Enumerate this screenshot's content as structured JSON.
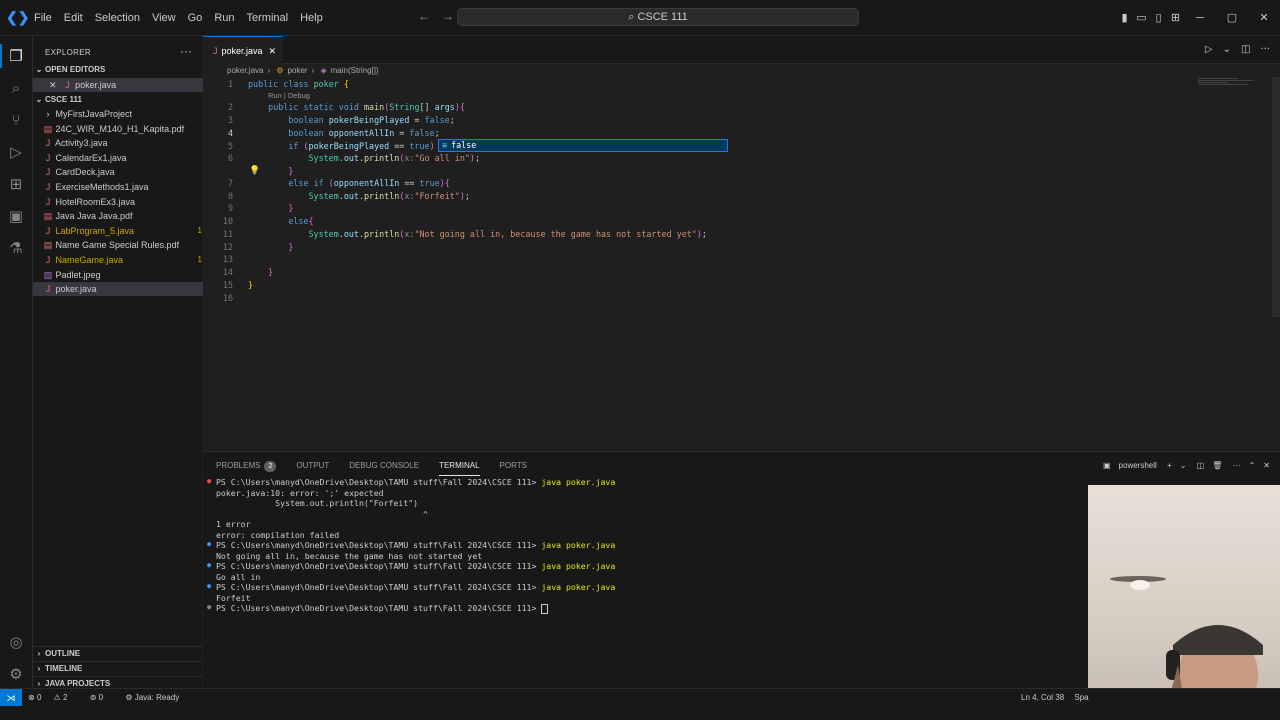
{
  "window": {
    "menu": [
      "File",
      "Edit",
      "Selection",
      "View",
      "Go",
      "Run",
      "Terminal",
      "Help"
    ],
    "command_center": "CSCE 111"
  },
  "sidebar": {
    "title": "EXPLORER",
    "open_editors_label": "OPEN EDITORS",
    "open_editors": [
      {
        "name": "poker.java"
      }
    ],
    "folder_label": "CSCE 111",
    "files": [
      {
        "name": "MyFirstJavaProject",
        "kind": "folder"
      },
      {
        "name": "24C_WIR_M140_H1_Kapita.pdf",
        "kind": "pdf"
      },
      {
        "name": "Activity3.java",
        "kind": "java"
      },
      {
        "name": "CalendarEx1.java",
        "kind": "java"
      },
      {
        "name": "CardDeck.java",
        "kind": "java"
      },
      {
        "name": "ExerciseMethods1.java",
        "kind": "java"
      },
      {
        "name": "HotelRoomEx3.java",
        "kind": "java"
      },
      {
        "name": "Java Java Java.pdf",
        "kind": "pdf"
      },
      {
        "name": "LabProgram_5.java",
        "kind": "java",
        "badge": "1"
      },
      {
        "name": "Name Game Special Rules.pdf",
        "kind": "pdf"
      },
      {
        "name": "NameGame.java",
        "kind": "java",
        "badge": "1"
      },
      {
        "name": "Padlet.jpeg",
        "kind": "image"
      },
      {
        "name": "poker.java",
        "kind": "java",
        "selected": true
      }
    ],
    "outline_label": "OUTLINE",
    "timeline_label": "TIMELINE",
    "java_projects_label": "JAVA PROJECTS"
  },
  "editor": {
    "tab_label": "poker.java",
    "breadcrumbs": [
      "poker.java",
      "poker",
      "main(String[])"
    ],
    "codelens": "Run | Debug",
    "suggestion": "false",
    "line_numbers": [
      "1",
      "2",
      "3",
      "4",
      "5",
      "6",
      "7",
      "8",
      "9",
      "10",
      "11",
      "12",
      "13",
      "14",
      "15",
      "16"
    ],
    "current_line": "4"
  },
  "panel": {
    "tabs": [
      {
        "label": "PROBLEMS",
        "count": "2"
      },
      {
        "label": "OUTPUT"
      },
      {
        "label": "DEBUG CONSOLE"
      },
      {
        "label": "TERMINAL",
        "active": true
      },
      {
        "label": "PORTS"
      }
    ],
    "shell": "powershell",
    "prompt": "PS C:\\Users\\manyd\\OneDrive\\Desktop\\TAMU stuff\\Fall 2024\\CSCE 111>",
    "command": "java poker.java",
    "lines": [
      "poker.java:10: error: ';' expected",
      "            System.out.println(\"Forfeit\")",
      "                                          ^",
      "1 error",
      "error: compilation failed",
      "Not going all in, because the game has not started yet",
      "Go all in",
      "Forfeit"
    ]
  },
  "status": {
    "errors": "0",
    "warnings": "2",
    "ports": "0",
    "java": "Java: Ready",
    "position": "Ln 4, Col 38",
    "spaces": "Spa"
  }
}
